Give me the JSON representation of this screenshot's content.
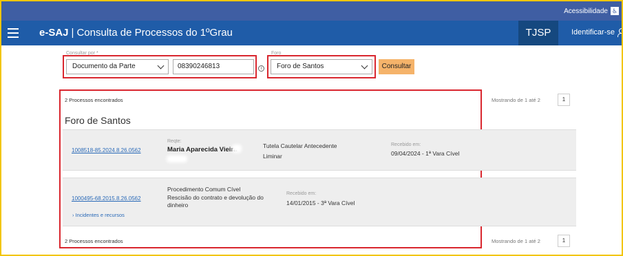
{
  "accessibility": {
    "label": "Acessibilidade",
    "icon": "accessibility-icon"
  },
  "header": {
    "brand": "e-SAJ",
    "title": "Consulta de Processos do 1ºGrau",
    "court": "TJSP",
    "login_label": "Identificar-se",
    "menu_icon": "hamburger-menu-icon",
    "user_icon": "user-icon"
  },
  "search": {
    "consultar_por_label": "Consultar por *",
    "consultar_por_value": "Documento da Parte",
    "document_value": "08390246813",
    "foro_label": "Foro",
    "foro_value": "Foro de Santos",
    "consultar_button": "Consultar"
  },
  "results": {
    "count_top": "2 Processos encontrados",
    "count_bottom": "2 Processos encontrados",
    "showing_top": "Mostrando de 1 até 2",
    "showing_bottom": "Mostrando de 1 até 2",
    "page": "1",
    "foro_group": "Foro de Santos",
    "items": [
      {
        "numero": "1008518-85.2024.8.26.0562",
        "parte_label": "Reqte:",
        "parte_nome": "Maria Aparecida Vieira",
        "classe_linha1": "Tutela Cautelar Antecedente",
        "classe_linha2": "Liminar",
        "recebido_label": "Recebido em:",
        "recebido_valor": "09/04/2024 - 1ª Vara Cível"
      },
      {
        "numero": "1000495-68.2015.8.26.0562",
        "classe_linha1": "Procedimento Comum Cível",
        "assunto": "Rescisão do contrato e devolução do dinheiro",
        "recebido_label": "Recebido em:",
        "recebido_valor": "14/01/2015 - 3ª Vara Cível",
        "incidentes": "Incidentes e recursos"
      }
    ]
  },
  "colors": {
    "topbar": "#3f5ea3",
    "header": "#1f5ca8",
    "court_box": "#15487f",
    "button": "#f5b36a",
    "highlight_border": "#d9262e",
    "card_bg": "#eeeeee",
    "link": "#2a6ab8"
  }
}
